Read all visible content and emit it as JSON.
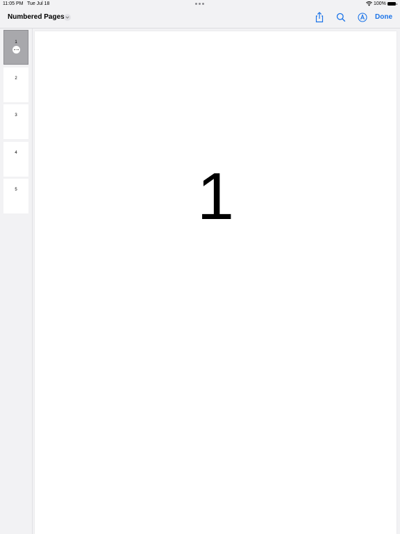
{
  "status_bar": {
    "time": "11:05 PM",
    "date": "Tue Jul 18",
    "battery_percent": "100%"
  },
  "nav": {
    "title": "Numbered Pages",
    "done_label": "Done",
    "accent_color": "#1a73e8"
  },
  "sidebar": {
    "thumbnails": [
      {
        "label": "1",
        "selected": true
      },
      {
        "label": "2",
        "selected": false
      },
      {
        "label": "3",
        "selected": false
      },
      {
        "label": "4",
        "selected": false
      },
      {
        "label": "5",
        "selected": false
      }
    ]
  },
  "page": {
    "content": "1"
  },
  "icons": [
    "wifi-icon",
    "battery-icon",
    "chevron-down-icon",
    "share-icon",
    "search-icon",
    "markup-icon",
    "more-icon"
  ]
}
